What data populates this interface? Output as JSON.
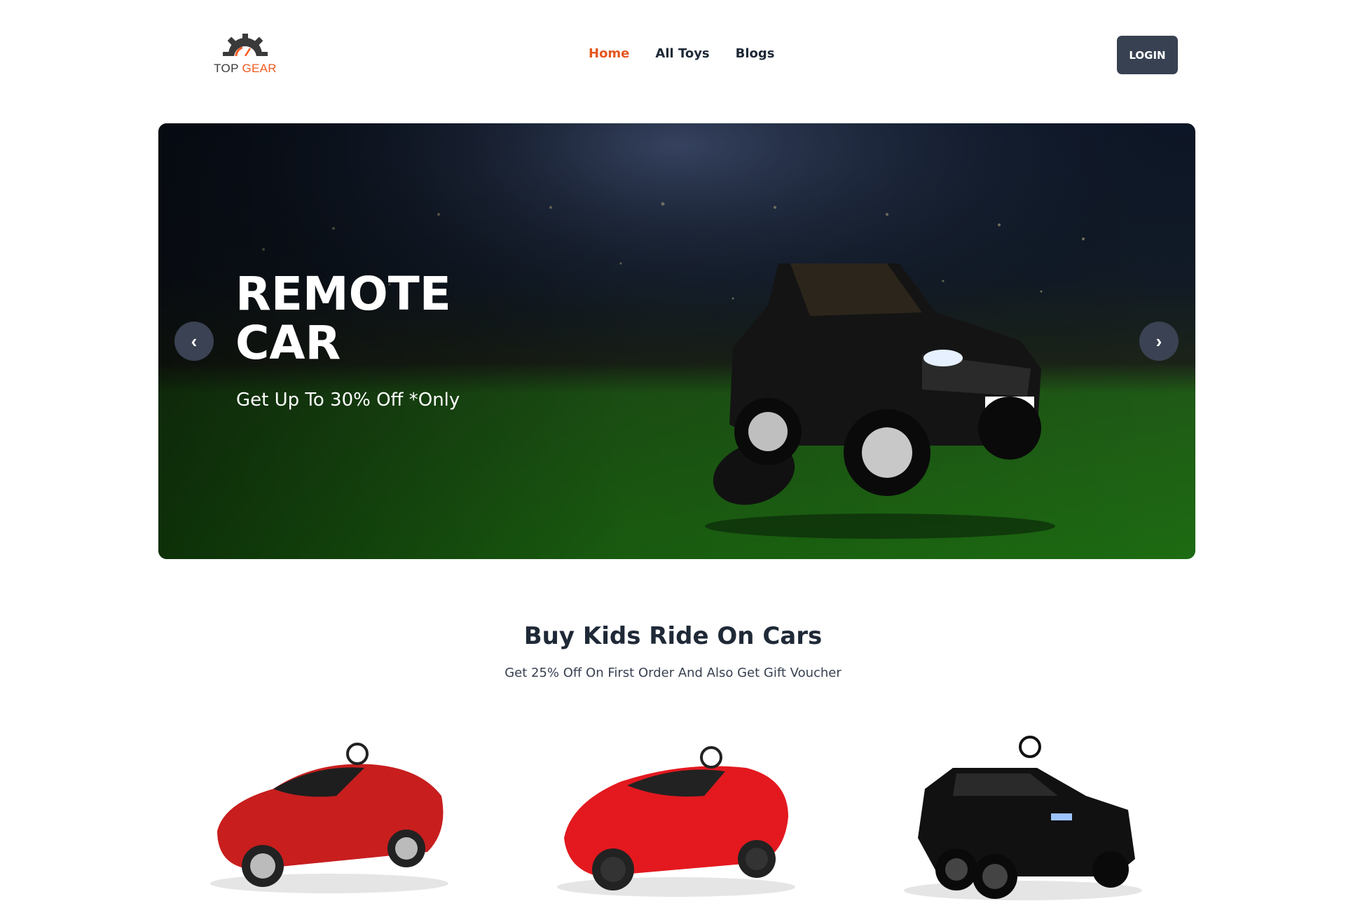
{
  "brand": {
    "logo_text_part1": "TOP ",
    "logo_text_part2": "GEAR",
    "logo_icon": "gear-speedometer-icon"
  },
  "nav": {
    "links": [
      {
        "label": "Home",
        "active": true
      },
      {
        "label": "All Toys",
        "active": false
      },
      {
        "label": "Blogs",
        "active": false
      }
    ],
    "login_label": "LOGIN"
  },
  "hero": {
    "title_line1": "REMOTE",
    "title_line2": "CAR",
    "subtitle": "Get Up To 30% Off *Only",
    "prev_label": "‹",
    "next_label": "›"
  },
  "section": {
    "title": "Buy Kids Ride On Cars",
    "subtitle": "Get 25% Off On First Order And Also Get Gift Voucher"
  },
  "products": [
    {
      "image": "red-tesla-ride-on-car",
      "color": "#c81e1e"
    },
    {
      "image": "red-sports-ride-on-car",
      "color": "#e3191f"
    },
    {
      "image": "black-suv-ride-on-car",
      "color": "#111111"
    }
  ],
  "colors": {
    "accent": "#e4571f",
    "button": "#374151",
    "text": "#1f2937"
  }
}
